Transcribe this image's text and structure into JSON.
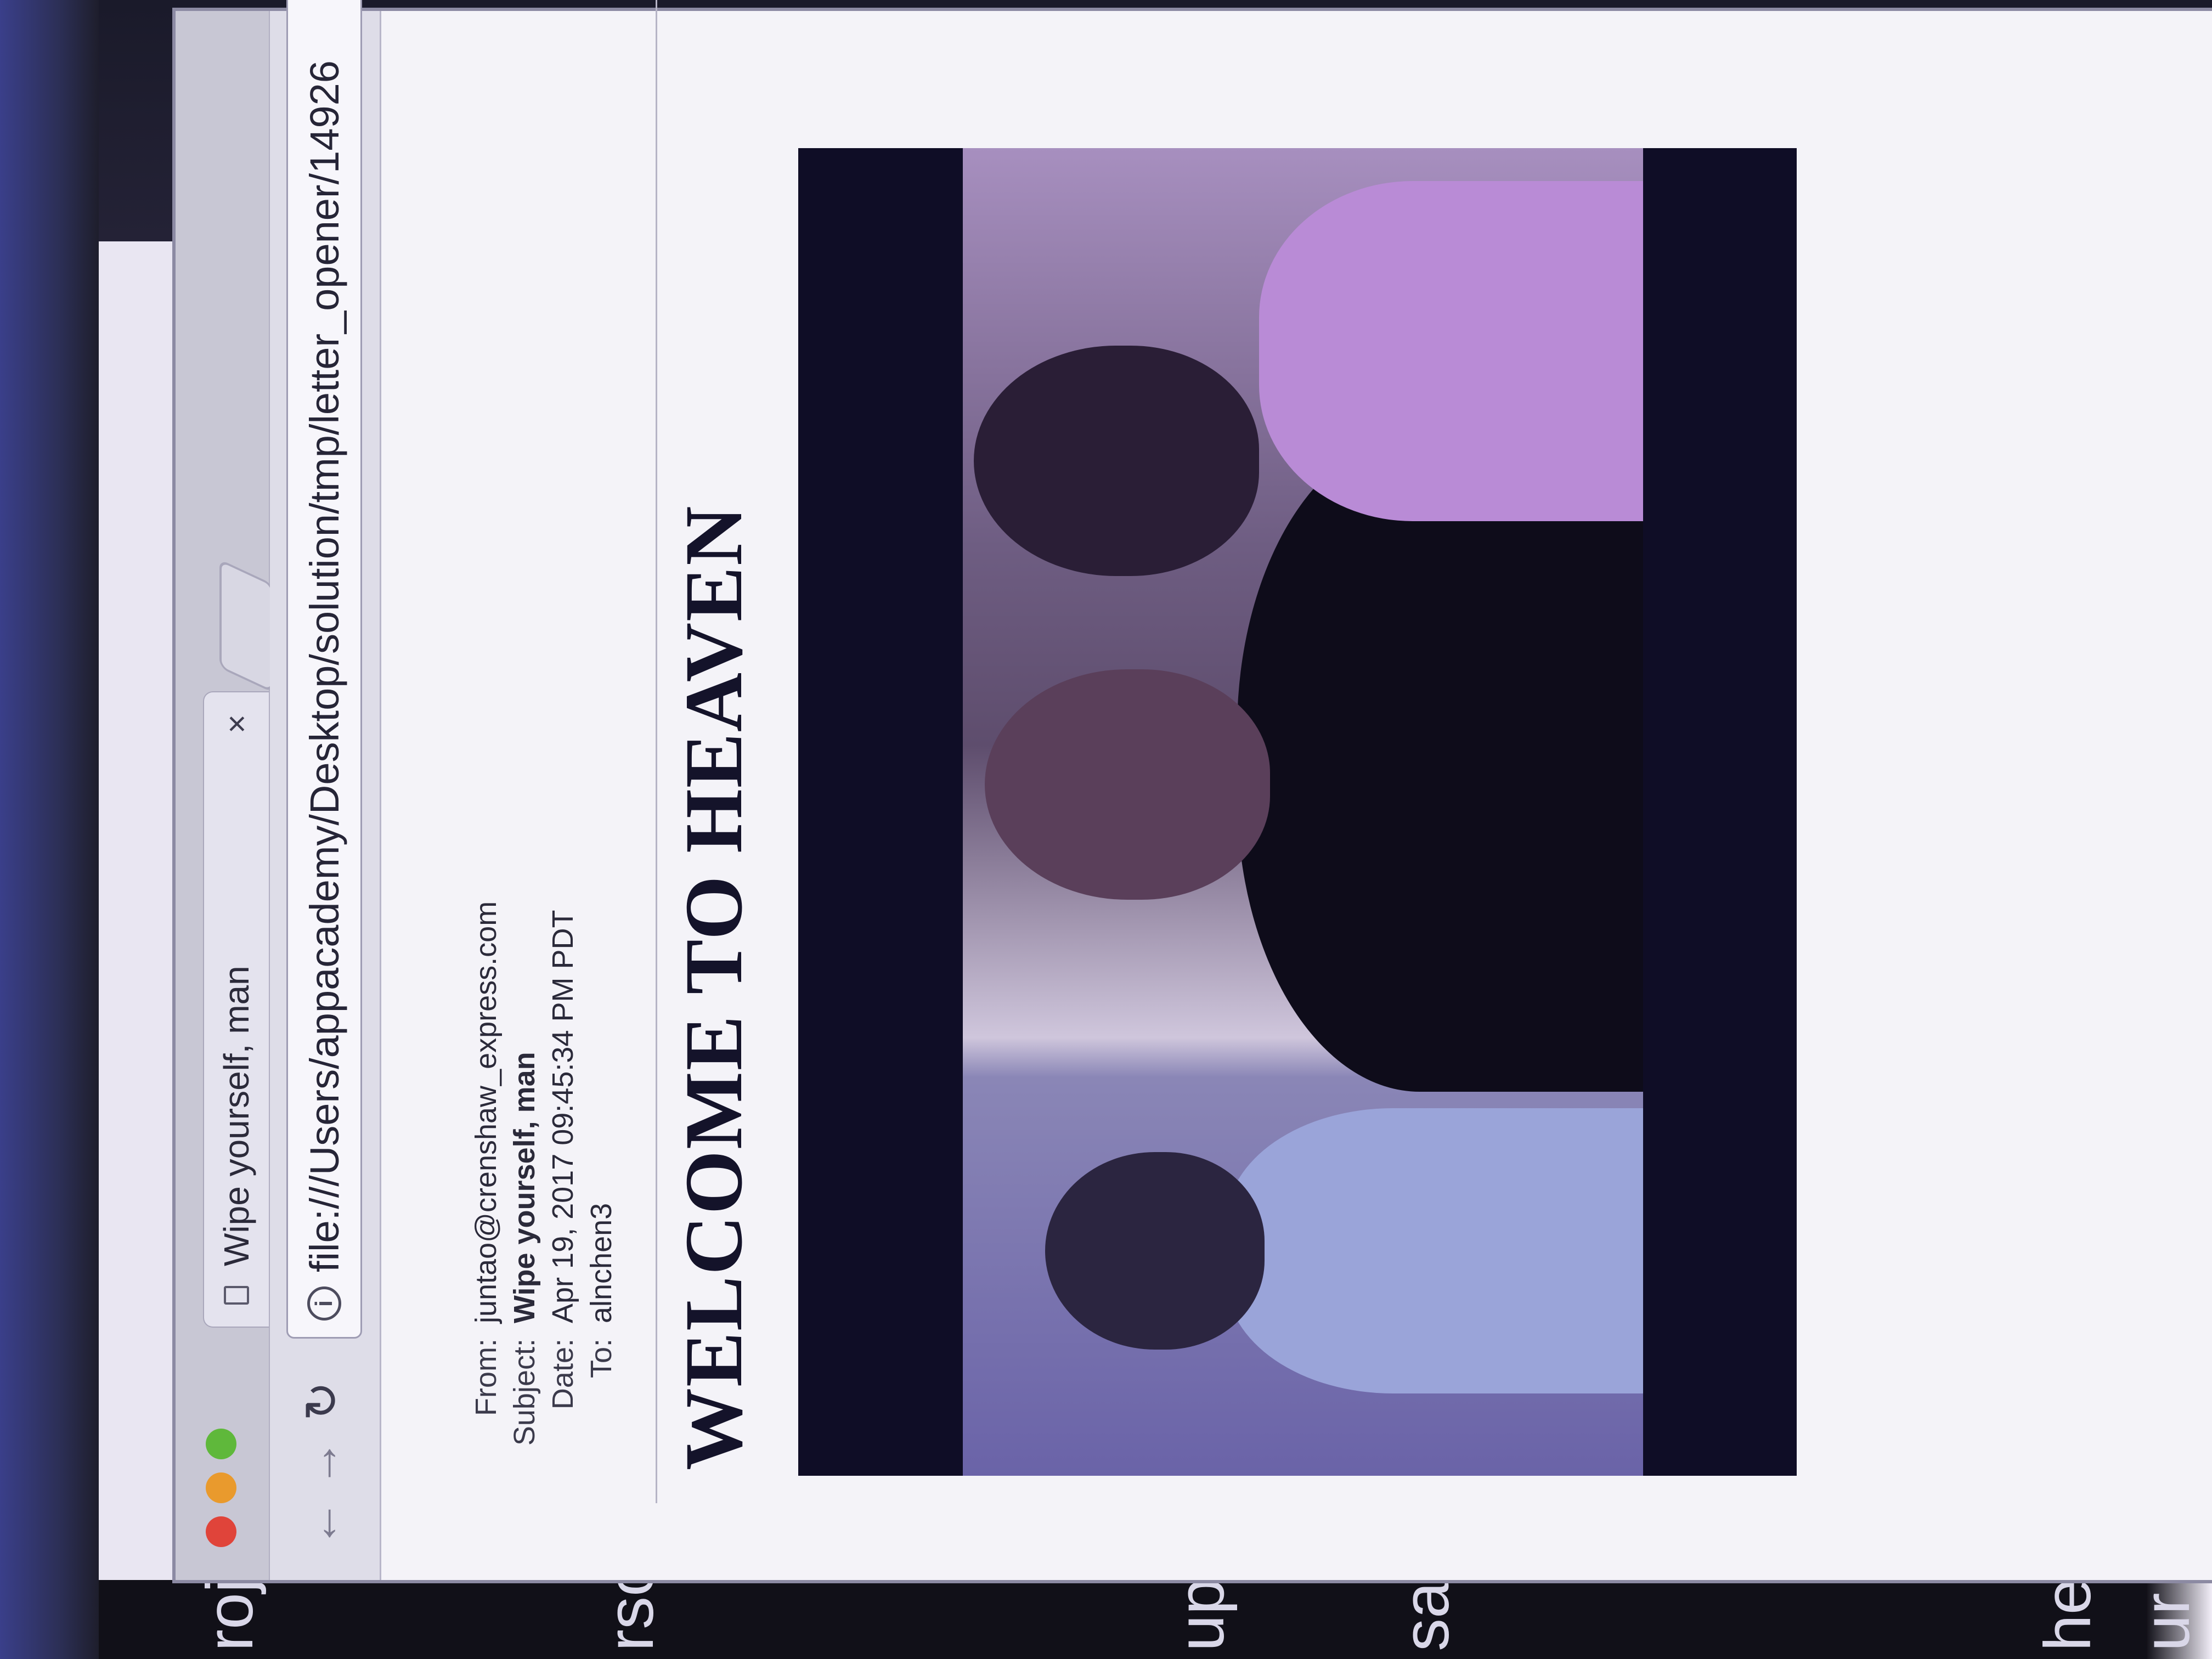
{
  "background_fragments": {
    "top_left": "roject",
    "left_1": "rso",
    "left_2": "up",
    "left_3": "sa",
    "left_4": "he",
    "left_5": "ur"
  },
  "browser": {
    "tab": {
      "title": "Wipe yourself, man",
      "close_glyph": "×"
    },
    "toolbar": {
      "back_glyph": "←",
      "forward_glyph": "→",
      "reload_glyph": "↻",
      "info_glyph": "i"
    },
    "address_bar": {
      "url": "file:///Users/appacademy/Desktop/solution/tmp/letter_opener/14926"
    }
  },
  "email": {
    "headers": {
      "from_label": "From:",
      "from_value": "juntao@crenshaw_express.com",
      "subject_label": "Subject:",
      "subject_value": "Wipe yourself, man",
      "date_label": "Date:",
      "date_value": "Apr 19, 2017 09:45:34 PM PDT",
      "to_label": "To:",
      "to_value": "alnchen3"
    },
    "heading": "WELCOME TO HEAVEN"
  }
}
